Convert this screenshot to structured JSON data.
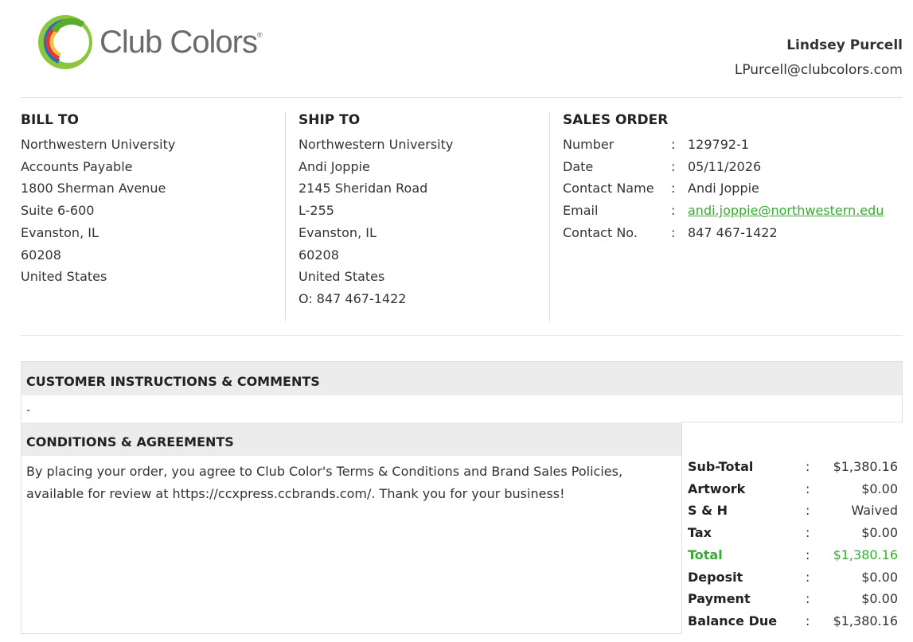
{
  "brand": {
    "name": "Club Colors",
    "reg_mark": "®",
    "green": "#3aaa35"
  },
  "rep": {
    "name": "Lindsey Purcell",
    "email": "LPurcell@clubcolors.com"
  },
  "bill_to": {
    "heading": "BILL TO",
    "lines": [
      "Northwestern University",
      "Accounts Payable",
      "1800 Sherman Avenue",
      "Suite 6-600",
      "Evanston, IL",
      "60208",
      "United States"
    ]
  },
  "ship_to": {
    "heading": "SHIP TO",
    "lines": [
      "Northwestern University",
      "Andi Joppie",
      "2145 Sheridan Road",
      "L-255",
      "Evanston, IL",
      "60208",
      "United States",
      "O: 847 467-1422"
    ]
  },
  "sales_order": {
    "heading": "SALES ORDER",
    "rows": [
      {
        "label": "Number",
        "value": "129792-1"
      },
      {
        "label": "Date",
        "value": "05/11/2026"
      },
      {
        "label": "Contact Name",
        "value": "Andi Joppie"
      },
      {
        "label": "Email",
        "value": "andi.joppie@northwestern.edu"
      },
      {
        "label": "Contact No.",
        "value": "847 467-1422"
      }
    ]
  },
  "instructions": {
    "heading": "CUSTOMER INSTRUCTIONS & COMMENTS",
    "text": "-"
  },
  "conditions": {
    "heading": "CONDITIONS & AGREEMENTS",
    "text": "By placing your order, you agree to Club Color's Terms & Conditions and Brand Sales Policies, available for review at https://ccxpress.ccbrands.com/. Thank you for your business!"
  },
  "totals": [
    {
      "label": "Sub-Total",
      "value": "$1,380.16"
    },
    {
      "label": "Artwork",
      "value": "$0.00"
    },
    {
      "label": "S & H",
      "value": "Waived"
    },
    {
      "label": "Tax",
      "value": "$0.00"
    },
    {
      "label": "Total",
      "value": "$1,380.16"
    },
    {
      "label": "Deposit",
      "value": "$0.00"
    },
    {
      "label": "Payment",
      "value": "$0.00"
    },
    {
      "label": "Balance Due",
      "value": "$1,380.16"
    }
  ],
  "colon": ":"
}
